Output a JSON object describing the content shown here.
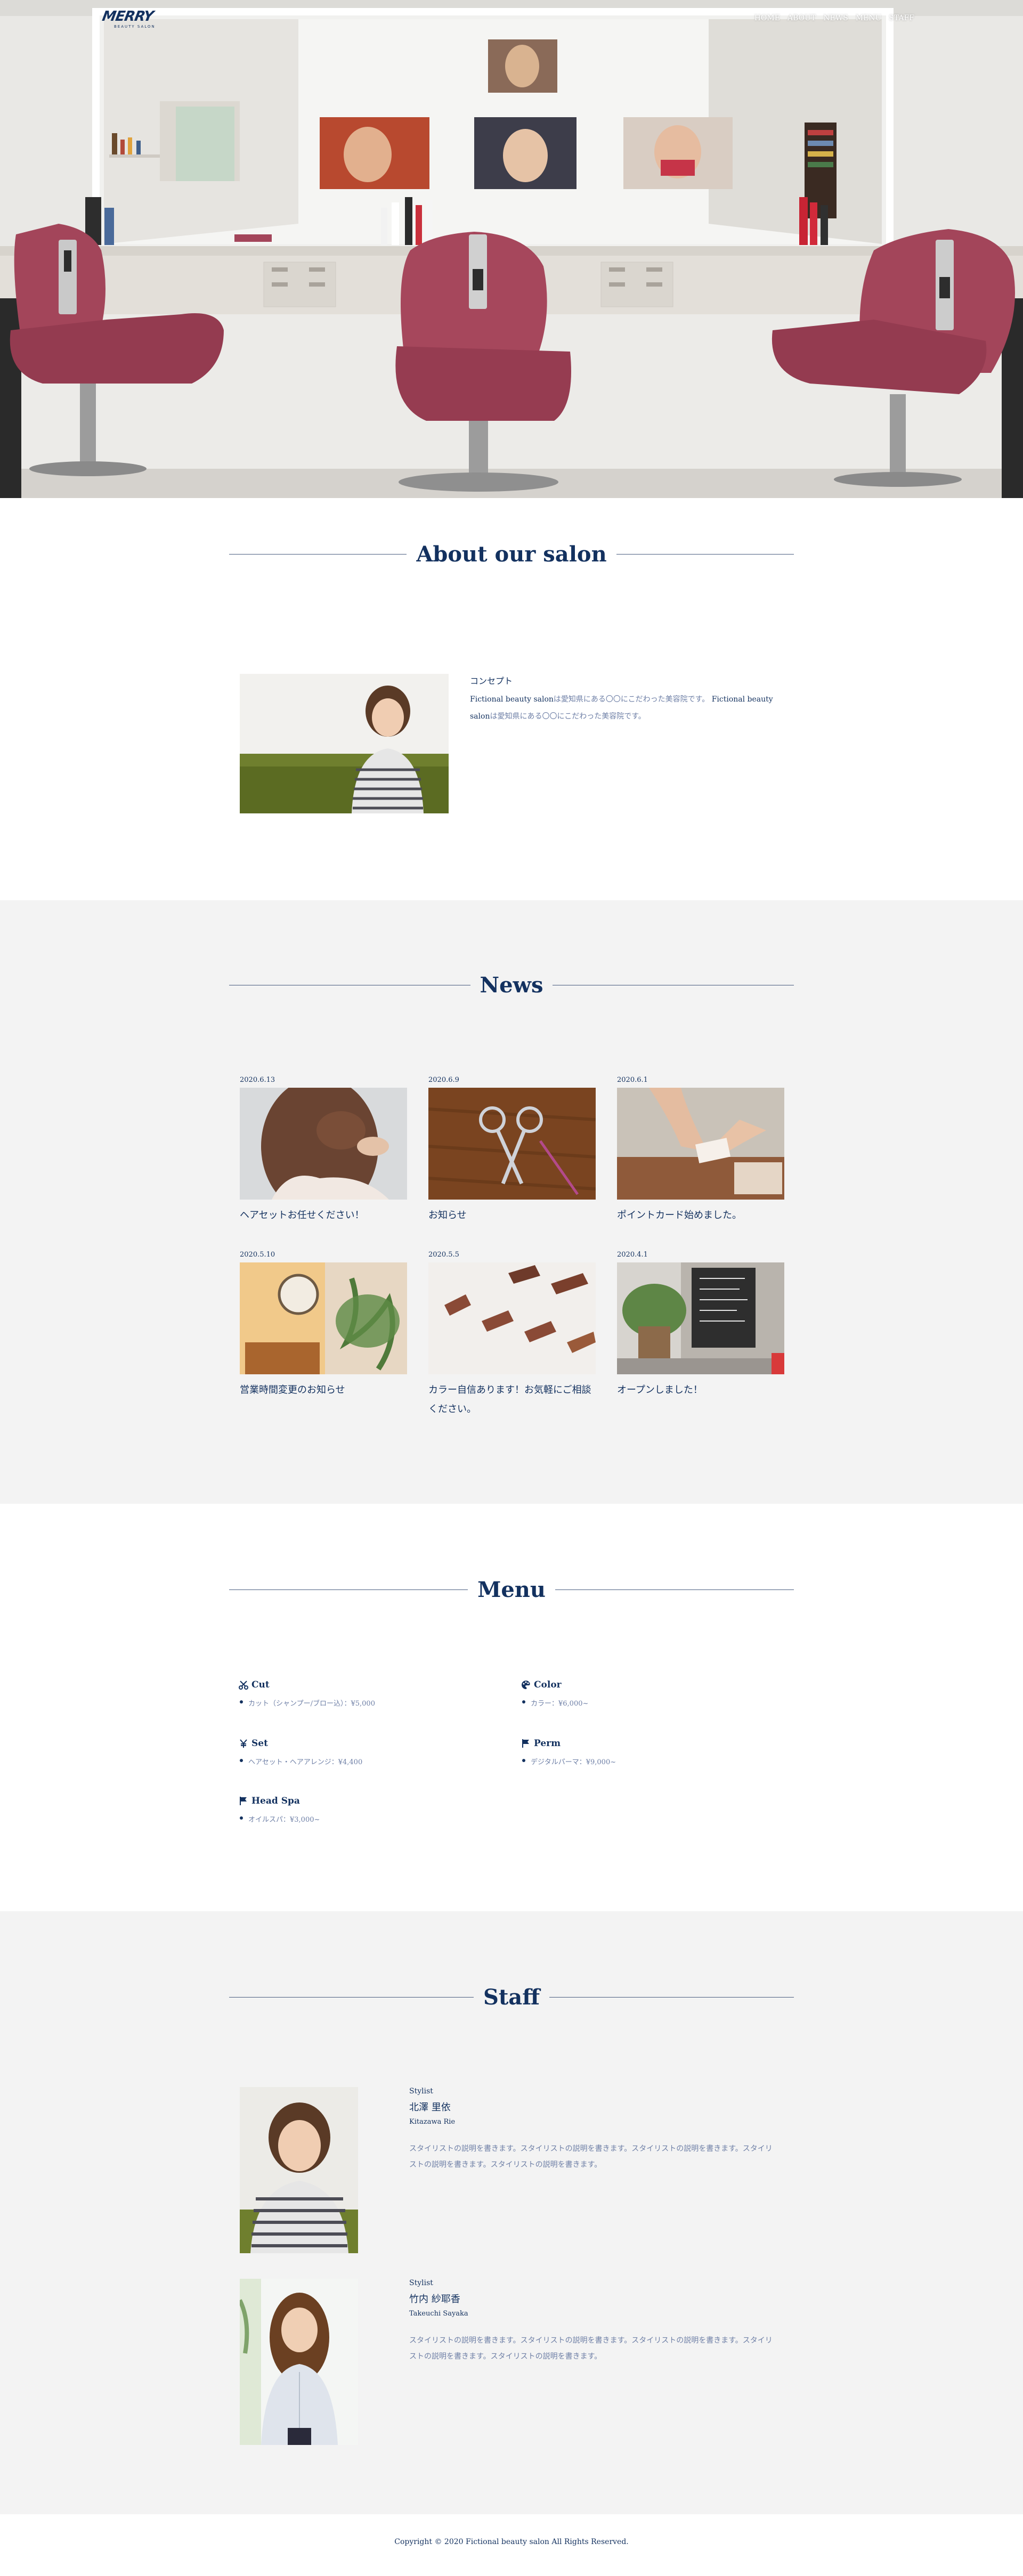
{
  "header": {
    "logo_text": "MERRY",
    "logo_sub": "BEAUTY SALON",
    "nav": [
      "HOME",
      "ABOUT",
      "NEWS",
      "MENU",
      "STAFF"
    ]
  },
  "about": {
    "title": "About our salon",
    "concept_label": "コンセプト",
    "desc_brand_1": "Fictional beauty salon",
    "desc_text_1": "は愛知県にある〇〇にこだわった美容院です。",
    "desc_brand_2": "Fictional beauty salon",
    "desc_text_2": "は愛知県にある〇〇にこだわった美容院です。"
  },
  "news": {
    "title": "News",
    "items": [
      {
        "date": "2020.6.13",
        "caption": "ヘアセットお任せください！"
      },
      {
        "date": "2020.6.9",
        "caption": "お知らせ"
      },
      {
        "date": "2020.6.1",
        "caption": "ポイントカード始めました。"
      },
      {
        "date": "2020.5.10",
        "caption": "営業時間変更のお知らせ"
      },
      {
        "date": "2020.5.5",
        "caption": "カラー自信あります！お気軽にご相談ください。"
      },
      {
        "date": "2020.4.1",
        "caption": "オープンしました！"
      }
    ]
  },
  "menu": {
    "title": "Menu",
    "items": [
      {
        "name": "Cut",
        "icon": "scissors-icon",
        "lines": [
          "カット（シャンプー/ブロー込）：¥5,000"
        ]
      },
      {
        "name": "Color",
        "icon": "palette-icon",
        "lines": [
          "カラー：¥6,000~"
        ]
      },
      {
        "name": "Set",
        "icon": "yen-icon",
        "lines": [
          "ヘアセット・ヘアアレンジ：¥4,400"
        ]
      },
      {
        "name": "Perm",
        "icon": "flag-icon",
        "lines": [
          "デジタルパーマ：¥9,000~"
        ]
      },
      {
        "name": "Head Spa",
        "icon": "flag-icon",
        "lines": [
          "オイルスパ：¥3,000~"
        ]
      }
    ]
  },
  "staff": {
    "title": "Staff",
    "members": [
      {
        "role": "Stylist",
        "name": "北澤 里依",
        "roman": "Kitazawa Rie",
        "bio": "スタイリストの説明を書きます。スタイリストの説明を書きます。スタイリストの説明を書きます。スタイリストの説明を書きます。スタイリストの説明を書きます。"
      },
      {
        "role": "Stylist",
        "name": "竹内 紗耶香",
        "roman": "Takeuchi Sayaka",
        "bio": "スタイリストの説明を書きます。スタイリストの説明を書きます。スタイリストの説明を書きます。スタイリストの説明を書きます。スタイリストの説明を書きます。"
      }
    ]
  },
  "footer": {
    "copyright": "Copyright © 2020 Fictional beauty salon All Rights Reserved."
  },
  "colors": {
    "brand_navy": "#13315f",
    "muted_text": "#6e7fa6",
    "section_gray": "#f3f3f3",
    "chair_red": "#a3455a"
  }
}
